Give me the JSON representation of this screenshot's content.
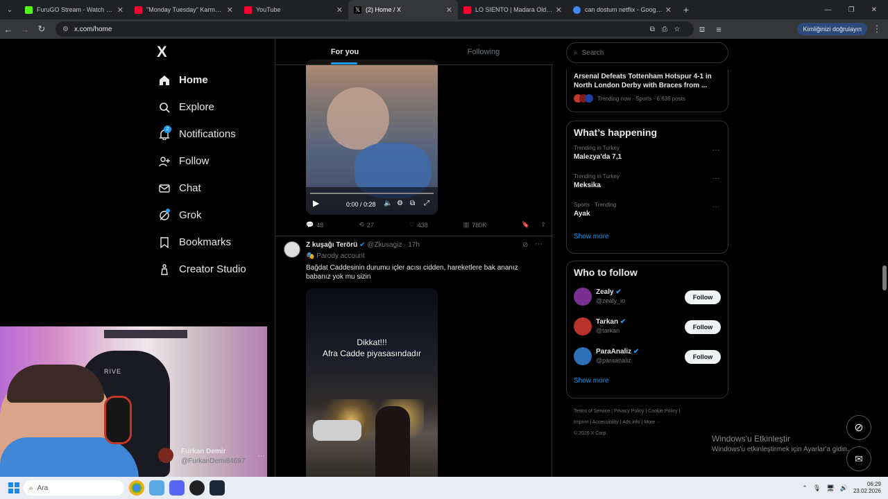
{
  "browser": {
    "tabs": [
      {
        "title": "FuruGO Stream - Watch Live on",
        "favicon_color": "#53fc18"
      },
      {
        "title": "\"Monday Tuesday\" Karma Video",
        "favicon_color": "#ff0033"
      },
      {
        "title": "YouTube",
        "favicon_color": "#ff0033"
      },
      {
        "title": "(2) Home / X",
        "favicon_color": "#000000",
        "active": true
      },
      {
        "title": "LO SIENTO | Madara Olduk #6",
        "favicon_color": "#ff0033"
      },
      {
        "title": "can dostum netflix - Google'da",
        "favicon_color": "#4285f4"
      }
    ],
    "url": "x.com/home",
    "verify_label": "Kimliğinizi doğrulayın"
  },
  "nav": {
    "logo": "X",
    "items": [
      {
        "label": "Home",
        "icon": "home-icon"
      },
      {
        "label": "Explore",
        "icon": "search-icon"
      },
      {
        "label": "Notifications",
        "icon": "bell-icon",
        "badge": "2"
      },
      {
        "label": "Follow",
        "icon": "person-add-icon"
      },
      {
        "label": "Chat",
        "icon": "mail-icon"
      },
      {
        "label": "Grok",
        "icon": "grok-icon"
      },
      {
        "label": "Bookmarks",
        "icon": "bookmark-icon"
      },
      {
        "label": "Creator Studio",
        "icon": "flask-icon"
      }
    ],
    "user": {
      "name": "Furkan Demir",
      "handle": "@FurkanDemi84697"
    }
  },
  "feed": {
    "tabs": [
      "For you",
      "Following"
    ],
    "tweet1": {
      "video_time": "0:00 / 0:28",
      "replies": "48",
      "retweets": "27",
      "likes": "438",
      "views": "780K"
    },
    "tweet2": {
      "name": "Z kuşağı Terörü",
      "handle": "@Zkusagiz",
      "time": "17h",
      "label": "Parody account",
      "text": "Bağdat Caddesinin durumu içler acısı cidden, hareketlere bak ananız babanız yok mu sizin",
      "video_caption_1": "Dikkat!!!",
      "video_caption_2": "Afra Cadde piyasasındadır"
    }
  },
  "sidebar": {
    "search_placeholder": "Search",
    "news": {
      "title": "Arsenal Defeats Tottenham Hotspur 4-1 in North London Derby with Braces from ...",
      "meta": "Trending now · Sports · 6,636 posts"
    },
    "happening": {
      "heading": "What’s happening",
      "trends": [
        {
          "meta": "Trending in Turkey",
          "name": "Malezya'da 7,1"
        },
        {
          "meta": "Trending in Turkey",
          "name": "Meksika"
        },
        {
          "meta": "Sports · Trending",
          "name": "Ayak"
        }
      ],
      "show_more": "Show more"
    },
    "who": {
      "heading": "Who to follow",
      "accounts": [
        {
          "name": "Zealy",
          "handle": "@zealy_io",
          "color": "#7a2e8f"
        },
        {
          "name": "Tarkan",
          "handle": "@tarkan",
          "color": "#b8332c"
        },
        {
          "name": "ParaAnaliz",
          "handle": "@paraanaliz",
          "color": "#2b6fb5"
        }
      ],
      "follow_label": "Follow",
      "show_more": "Show more"
    },
    "footer": {
      "links": [
        "Terms of Service",
        "Privacy Policy",
        "Cookie Policy",
        "Imprint",
        "Accessibility",
        "Ads info",
        "More ···"
      ],
      "copyright": "© 2026 X Corp."
    }
  },
  "webcam": {
    "chair_text": "RIVE"
  },
  "windows": {
    "watermark_title": "Windows'u Etkinleştir",
    "watermark_sub": "Windows'u etkinleştirmek için Ayarlar'a gidin.",
    "search_label": "Ara",
    "time": "06:29",
    "date": "23.02.2026"
  }
}
